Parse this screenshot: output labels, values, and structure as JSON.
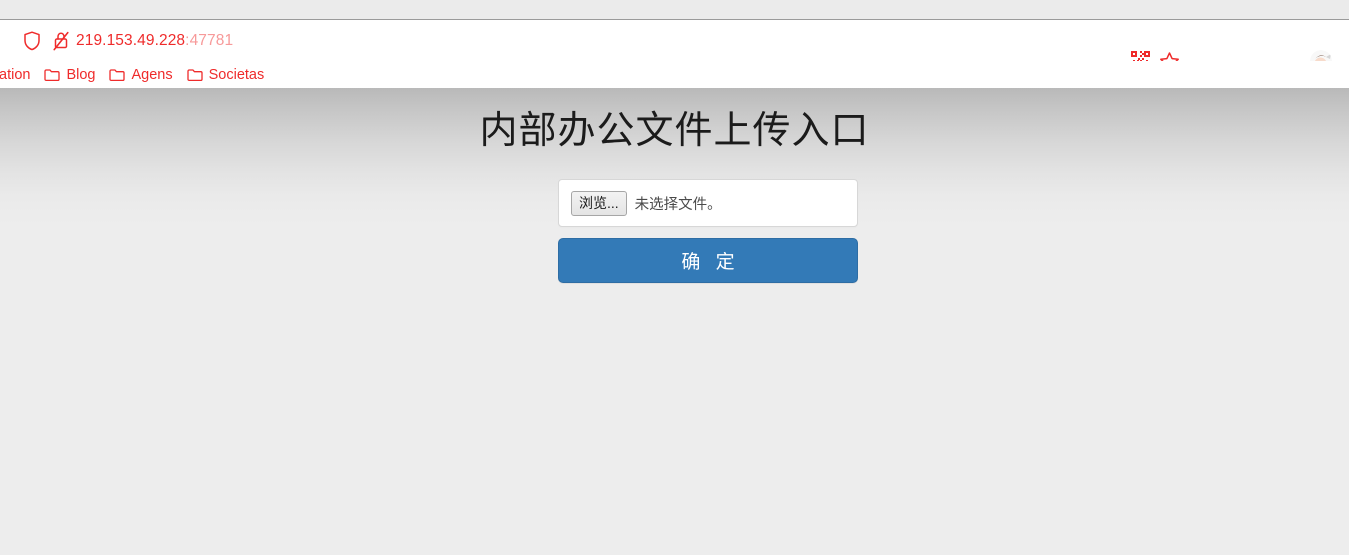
{
  "browser": {
    "url": {
      "host": "219.153.49.228",
      "port": ":47781"
    },
    "icons": {
      "shield": "shield-icon",
      "lock_broken": "lock-broken-insecure-icon",
      "qr": "qr-code-icon",
      "star": "star-bookmark-icon",
      "avatar": "profile-avatar"
    },
    "bookmarks": [
      {
        "label": "ation",
        "icon": "folder-icon",
        "clipped": true
      },
      {
        "label": "Blog",
        "icon": "folder-icon",
        "clipped": false
      },
      {
        "label": "Agens",
        "icon": "folder-icon",
        "clipped": false
      },
      {
        "label": "Societas",
        "icon": "folder-icon",
        "clipped": false
      }
    ]
  },
  "page": {
    "title": "内部办公文件上传入口",
    "file_input": {
      "browse_label": "浏览...",
      "status_text": "未选择文件。"
    },
    "submit_label": "确 定"
  },
  "colors": {
    "accent_blue": "#337ab7",
    "accent_blue_border": "#2e6da4",
    "chrome_red": "#ef2b2b",
    "chrome_red_faded": "#f79a9a",
    "page_gradient_top": "#b9b9b9",
    "page_gradient_bottom": "#ededed",
    "title_text": "#1b1b1b"
  }
}
